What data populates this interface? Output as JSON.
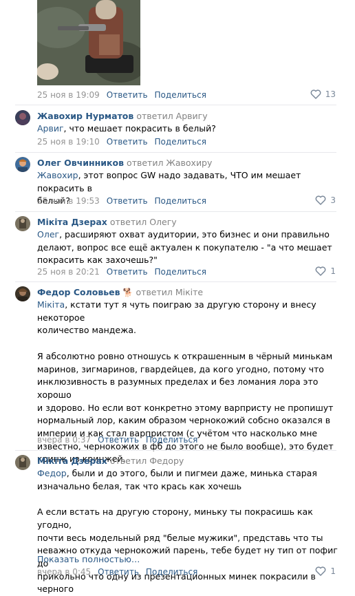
{
  "top_comment": {
    "date": "25 ноя в 19:09",
    "reply": "Ответить",
    "share": "Поделиться",
    "likes": "13"
  },
  "comments": [
    {
      "author": "Жавохир Нурматов",
      "replied": "ответил Арвигу",
      "addressee": "Арвиг",
      "text": ", что мешает покрасить в белый?",
      "date": "25 ноя в 19:10",
      "reply": "Ответить",
      "share": "Поделиться",
      "likes": ""
    },
    {
      "author": "Олег Овчинников",
      "replied": "ответил Жавохиру",
      "addressee": "Жавохир",
      "text": ", этот вопрос GW надо задавать, ЧТО им мешает покрасить в\nбелый?",
      "date": "25 ноя в 19:53",
      "reply": "Ответить",
      "share": "Поделиться",
      "likes": "3"
    },
    {
      "author": "Мікіта Дзерах",
      "replied": "ответил Олегу",
      "addressee": "Олег",
      "text": ", расширяют охват аудитории, это бизнес и они правильно\nделают, вопрос все ещё актуален к покупателю - \"а что мешает\nпокрасить как захочешь?\"",
      "date": "25 ноя в 20:21",
      "reply": "Ответить",
      "share": "Поделиться",
      "likes": "1"
    },
    {
      "author": "Федор Соловьев",
      "author_badge": "🐕",
      "replied": "ответил Мікіте",
      "addressee": "Мікіта",
      "text": ", кстати тут я чуть поиграю за другую сторону и внесу некоторое\nколичество мандежа.\n\nЯ абсолютно ровно отношусь к открашенным в чёрный минькам\nмаринов, зигмаринов, гвардейцев, да кого угодно, потому что\nинклюзивность в разумных пределах и без ломания лора это хорошо\nи здорово. Но если вот конкретно этому варпристу не пропишут\nнормальный лор, каким образом чернокожий собсно оказался в\nимперии и как стал варпристом (с учётом что насколько мне\nизвестно, чернокожих в фб до этого не было вообще), это будет\nкринж из кринжей.",
      "date": "вчера в 0:37",
      "reply": "Ответить",
      "share": "Поделиться",
      "likes": ""
    },
    {
      "author": "Мікіта Дзерах",
      "replied": "ответил Федору",
      "addressee": "Федор",
      "text": ", были и до этого, были и пигмеи даже, минька старая\nизначально белая, так что крась как хочешь\n\nА если встать на другую сторону, миньку ты покрасишь как угодно,\nпочти весь модельный ряд \"белые мужики\", представь что ты\nневажно откуда чернокожий парень, тебе будет ну тип от пофиг до\nприкольно что одну из презентационных минек покрасили в черного",
      "more": "Показать полностью…",
      "date": "вчера в 0:45",
      "reply": "Ответить",
      "share": "Поделиться",
      "likes": "1"
    }
  ]
}
